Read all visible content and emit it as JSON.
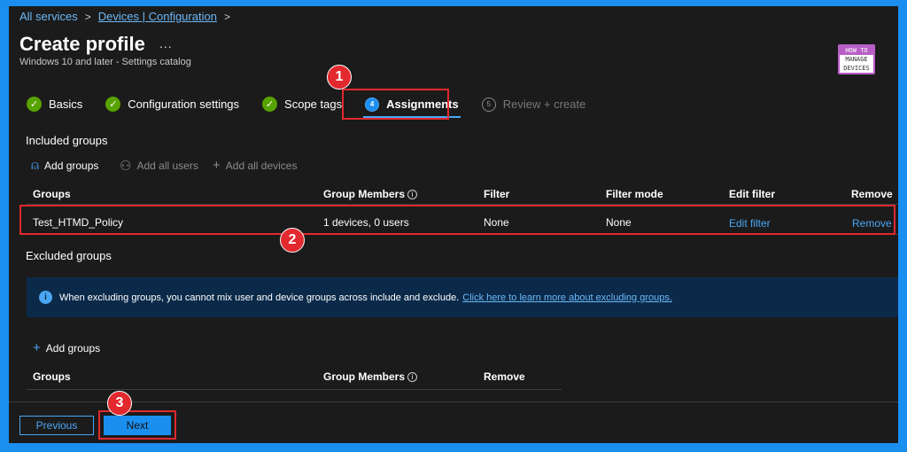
{
  "breadcrumb": {
    "item1": "All services",
    "item2": "Devices | Configuration",
    "sep": ">"
  },
  "header": {
    "title": "Create profile",
    "more": "...",
    "subtitle": "Windows 10 and later - Settings catalog"
  },
  "logo": {
    "line1": "HOW TO",
    "line2": "MANAGE",
    "line3": "DEVICES"
  },
  "steps": [
    {
      "label": "Basics",
      "state": "complete"
    },
    {
      "label": "Configuration settings",
      "state": "complete"
    },
    {
      "label": "Scope tags",
      "state": "complete"
    },
    {
      "label": "Assignments",
      "number": "4",
      "state": "active"
    },
    {
      "label": "Review + create",
      "number": "5",
      "state": "disabled"
    }
  ],
  "callouts": {
    "one": "1",
    "two": "2",
    "three": "3"
  },
  "included": {
    "label": "Included groups",
    "commands": {
      "add_groups": "Add groups",
      "add_all_users": "Add all users",
      "add_all_devices": "Add all devices"
    },
    "columns": {
      "groups": "Groups",
      "members": "Group Members",
      "filter": "Filter",
      "filter_mode": "Filter mode",
      "edit_filter": "Edit filter",
      "remove": "Remove"
    },
    "row": {
      "group": "Test_HTMD_Policy",
      "members": "1 devices, 0 users",
      "filter": "None",
      "filter_mode": "None",
      "edit_filter": "Edit filter",
      "remove": "Remove"
    }
  },
  "excluded": {
    "label": "Excluded groups",
    "info_text": "When excluding groups, you cannot mix user and device groups across include and exclude.",
    "info_link": "Click here to learn more about excluding groups.",
    "add_groups": "Add groups",
    "columns": {
      "groups": "Groups",
      "members": "Group Members",
      "remove": "Remove"
    }
  },
  "footer": {
    "previous": "Previous",
    "next": "Next"
  },
  "colors": {
    "accent": "#1b8ff0",
    "highlight": "#e2292e",
    "success": "#57a300",
    "background": "#1b1b1b"
  }
}
